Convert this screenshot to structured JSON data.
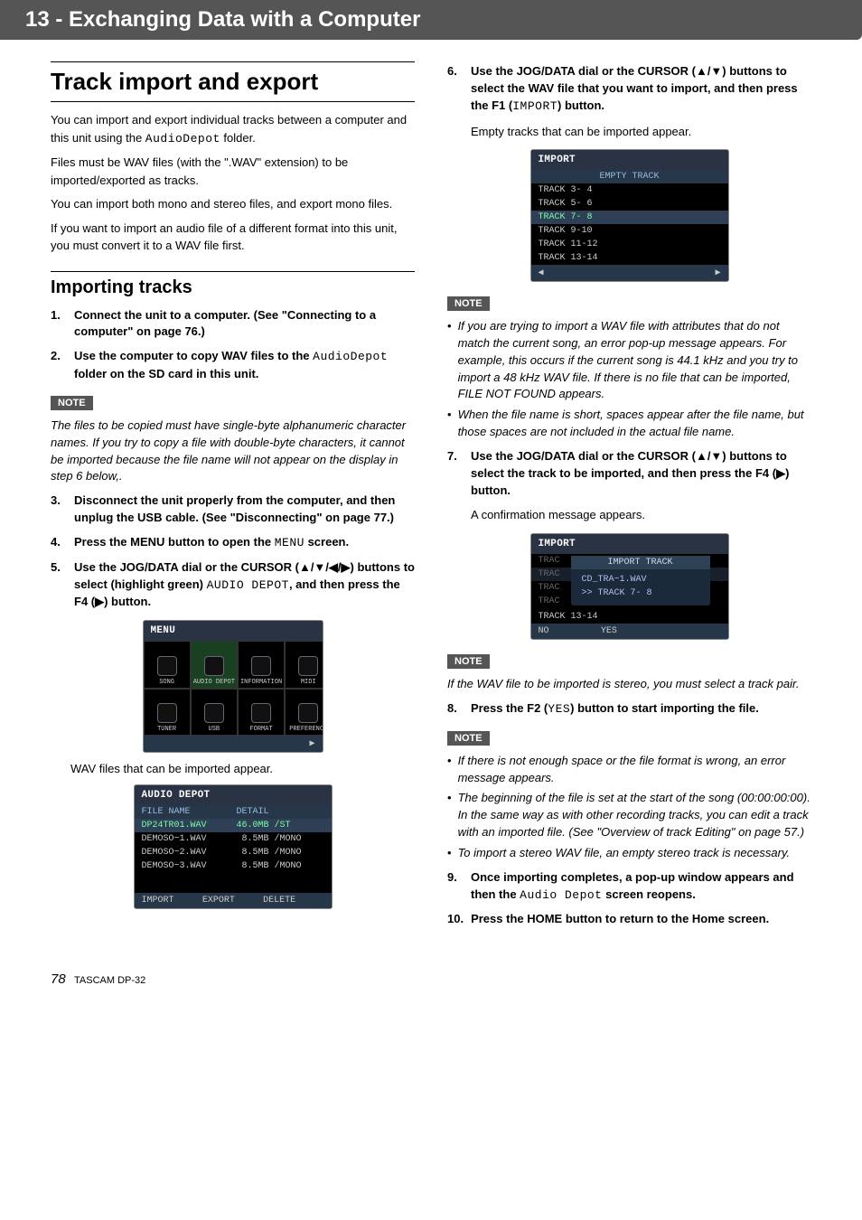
{
  "header": "13 - Exchanging Data with a Computer",
  "section_title": "Track import and export",
  "p1": "You can import and export individual tracks between a computer and this unit using the ",
  "p1_code": "AudioDepot",
  "p1_tail": " folder.",
  "p2": "Files must be WAV files (with the \".WAV\" extension) to be imported/exported as tracks.",
  "p3": "You can import both mono and stereo files, and export mono files.",
  "p4": "If you want to import an audio file of a different format into this unit, you must convert it to a WAV file first.",
  "h2_importing": "Importing tracks",
  "steps_left": {
    "s1": "Connect the unit to a computer. (See \"Connecting to a computer\" on page 76.)",
    "s2_pre": "Use the computer to copy WAV files to the ",
    "s2_code": "AudioDepot",
    "s2_post": " folder on the SD card in this unit.",
    "s3": "Disconnect the unit properly from the computer, and then unplug the USB cable. (See \"Disconnecting\" on page 77.)",
    "s4_pre": "Press the MENU button to open the ",
    "s4_code": "MENU",
    "s4_post": " screen.",
    "s5_pre": "Use the JOG/DATA dial or the CURSOR (▲/▼/◀/▶) buttons to select (highlight green) ",
    "s5_code": "AUDIO DEPOT",
    "s5_post": ", and then press the F4 (▶) button."
  },
  "caption_left": "WAV files that can be imported appear.",
  "note1_text": "The files to be copied must have single-byte alphanumeric character names. If you try to copy a file with double-byte characters, it cannot be imported because the file name will not appear on the display in step 6 below,.",
  "note_label": "NOTE",
  "menu_shot": {
    "title": "MENU",
    "cells": [
      "SONG",
      "AUDIO DEPOT",
      "INFORMATION",
      "MIDI",
      "TUNER",
      "USB",
      "FORMAT",
      "PREFERENCE"
    ]
  },
  "depot_shot": {
    "title": "AUDIO DEPOT",
    "header": [
      "FILE NAME",
      "DETAIL"
    ],
    "rows": [
      [
        "DP24TR01.WAV",
        "46.0MB /ST"
      ],
      [
        "DEMOSO~1.WAV",
        " 8.5MB /MONO"
      ],
      [
        "DEMOSO~2.WAV",
        " 8.5MB /MONO"
      ],
      [
        "DEMOSO~3.WAV",
        " 8.5MB /MONO"
      ]
    ],
    "footer": [
      "IMPORT",
      "EXPORT",
      "DELETE"
    ]
  },
  "steps_right": {
    "s6_pre": "Use the JOG/DATA dial or the CURSOR (▲/▼) buttons to select the WAV file that you want to import, and then press the F1 (",
    "s6_code": "IMPORT",
    "s6_post": ") button.",
    "s6_result": "Empty tracks that can be imported appear.",
    "s7": "Use the JOG/DATA dial or the CURSOR (▲/▼) buttons to select the track to be imported, and then press the F4 (▶) button.",
    "s7_result": "A confirmation message appears.",
    "s8_pre": "Press the F2 (",
    "s8_code": "YES",
    "s8_post": ") button to start importing the file.",
    "s9_pre": "Once importing completes, a pop-up window appears and then the ",
    "s9_code": "Audio Depot",
    "s9_post": " screen reopens.",
    "s10": "Press the HOME button to return to the Home screen."
  },
  "import_shot": {
    "title": "IMPORT",
    "header": "EMPTY TRACK",
    "rows": [
      "TRACK  3- 4",
      "TRACK  5- 6",
      "TRACK  7- 8",
      "TRACK  9-10",
      "TRACK 11-12",
      "TRACK 13-14"
    ],
    "footer_l": "◀",
    "footer_r": "▶"
  },
  "import_shot2": {
    "title": "IMPORT",
    "pop_title": "IMPORT TRACK",
    "pop_line1": "CD_TRA~1.WAV",
    "pop_line2": ">> TRACK  7- 8",
    "row_extra": "TRACK 13-14",
    "footer": [
      "NO",
      "YES"
    ]
  },
  "note2_bullets": [
    "If you are trying to import a WAV file with attributes that do not match the current song, an error pop-up message appears. For example, this occurs if the current song is 44.1 kHz and you try to import a 48 kHz WAV file. If there is no file that can be imported, FILE NOT FOUND appears.",
    "When the file name is short, spaces appear after the file name, but those spaces are not included in the actual file name."
  ],
  "note3_text": "If the WAV file to be imported is stereo, you must select a track pair.",
  "note4_bullets": [
    "If there is not enough space or the file format is wrong, an error message appears.",
    "The beginning of the file is set at the start of the song (00:00:00:00). In the same way as with other recording tracks, you can edit a track with an imported file. (See \"Overview of track Editing\" on page 57.)",
    "To import a stereo WAV file, an empty stereo track is necessary."
  ],
  "footer": {
    "page": "78",
    "product": "TASCAM DP-32"
  }
}
